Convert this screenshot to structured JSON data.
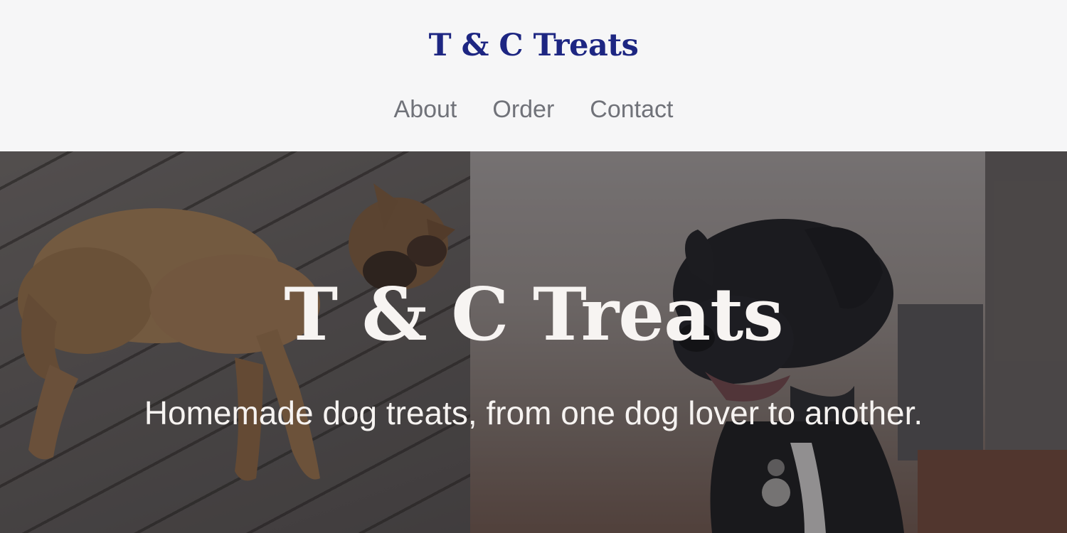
{
  "header": {
    "brand": "T & C Treats",
    "nav": [
      {
        "label": "About"
      },
      {
        "label": "Order"
      },
      {
        "label": "Contact"
      }
    ]
  },
  "hero": {
    "title": "T & C Treats",
    "tagline": "Homemade dog treats, from one dog lover to another."
  },
  "colors": {
    "brand": "#1d2682",
    "nav_text": "#707279",
    "header_bg": "#f6f6f7",
    "hero_text": "#f7f4f2"
  }
}
